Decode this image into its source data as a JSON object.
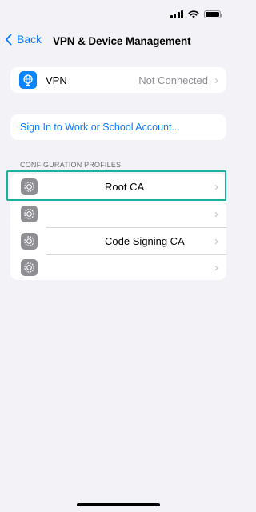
{
  "status_bar": {
    "signal": "signal-bars-icon",
    "wifi": "wifi-icon",
    "battery": "battery-icon"
  },
  "nav": {
    "back_label": "Back",
    "title": "VPN & Device Management"
  },
  "vpn": {
    "label": "VPN",
    "status": "Not Connected",
    "icon": "globe-network-icon"
  },
  "sign_in": {
    "label": "Sign In to Work or School Account..."
  },
  "profiles": {
    "header": "CONFIGURATION PROFILES",
    "items": [
      {
        "label": "Root CA"
      },
      {
        "label": ""
      },
      {
        "label": "Code Signing CA"
      },
      {
        "label": ""
      }
    ]
  },
  "colors": {
    "accent": "#0a7aff",
    "highlight": "#17b3a0",
    "background": "#f2f2f7",
    "profile_icon": "#8e8e93"
  }
}
